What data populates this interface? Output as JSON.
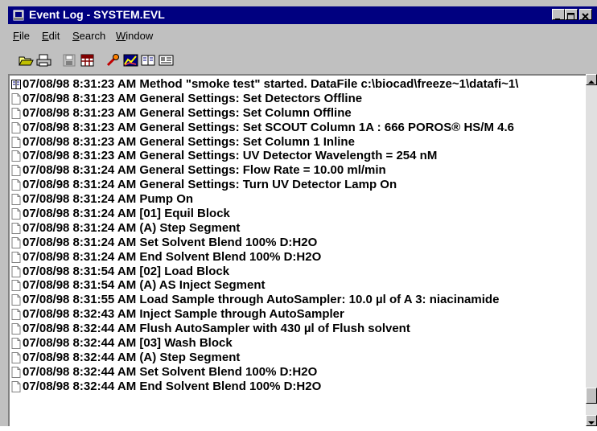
{
  "window": {
    "title": "Event Log - SYSTEM.EVL"
  },
  "menu": [
    {
      "label": "File"
    },
    {
      "label": "Edit"
    },
    {
      "label": "Search"
    },
    {
      "label": "Window"
    }
  ],
  "toolbar": {
    "icons": [
      "open-folder-icon",
      "printer-icon",
      "save-disabled-icon",
      "grid-icon",
      "wrench-icon",
      "chart-icon",
      "book-icon",
      "id-card-icon"
    ]
  },
  "log": {
    "entries": [
      {
        "icon": "book-icon",
        "text": "07/08/98 8:31:23 AM Method \"smoke test\" started. DataFile c:\\biocad\\freeze~1\\datafi~1\\"
      },
      {
        "icon": "document-icon",
        "text": "07/08/98 8:31:23 AM General Settings: Set Detectors Offline"
      },
      {
        "icon": "document-icon",
        "text": "07/08/98 8:31:23 AM General Settings: Set Column Offline"
      },
      {
        "icon": "document-icon",
        "text": "07/08/98 8:31:23 AM General Settings: Set SCOUT Column 1A : 666 POROS® HS/M  4.6"
      },
      {
        "icon": "document-icon",
        "text": "07/08/98 8:31:23 AM General Settings: Set Column 1 Inline"
      },
      {
        "icon": "document-icon",
        "text": "07/08/98 8:31:23 AM General Settings: UV Detector Wavelength = 254 nM"
      },
      {
        "icon": "document-icon",
        "text": "07/08/98 8:31:24 AM General Settings: Flow Rate = 10.00 ml/min"
      },
      {
        "icon": "document-icon",
        "text": "07/08/98 8:31:24 AM General Settings: Turn UV Detector Lamp On"
      },
      {
        "icon": "document-icon",
        "text": "07/08/98 8:31:24 AM Pump On"
      },
      {
        "icon": "document-icon",
        "text": "07/08/98 8:31:24 AM [01] Equil Block"
      },
      {
        "icon": "document-icon",
        "text": "07/08/98 8:31:24 AM (A) Step Segment"
      },
      {
        "icon": "document-icon",
        "text": "07/08/98 8:31:24 AM Set Solvent Blend  100% D:H2O"
      },
      {
        "icon": "document-icon",
        "text": "07/08/98 8:31:24 AM End Solvent Blend  100% D:H2O"
      },
      {
        "icon": "document-icon",
        "text": "07/08/98 8:31:54 AM [02] Load Block"
      },
      {
        "icon": "document-icon",
        "text": "07/08/98 8:31:54 AM (A) AS Inject Segment"
      },
      {
        "icon": "document-icon",
        "text": "07/08/98 8:31:55 AM Load Sample through AutoSampler: 10.0 µl of A 3: niacinamide"
      },
      {
        "icon": "document-icon",
        "text": "07/08/98 8:32:43 AM Inject Sample through AutoSampler"
      },
      {
        "icon": "document-icon",
        "text": "07/08/98 8:32:44 AM Flush AutoSampler with 430 µl of Flush solvent"
      },
      {
        "icon": "document-icon",
        "text": "07/08/98 8:32:44 AM [03] Wash Block"
      },
      {
        "icon": "document-icon",
        "text": "07/08/98 8:32:44 AM (A) Step Segment"
      },
      {
        "icon": "document-icon",
        "text": "07/08/98 8:32:44 AM Set Solvent Blend  100% D:H2O"
      },
      {
        "icon": "document-icon",
        "text": "07/08/98 8:32:44 AM End Solvent Blend  100% D:H2O"
      }
    ]
  },
  "colors": {
    "titlebar": "#000080",
    "chrome": "#c0c0c0",
    "pane": "#ffffff"
  }
}
